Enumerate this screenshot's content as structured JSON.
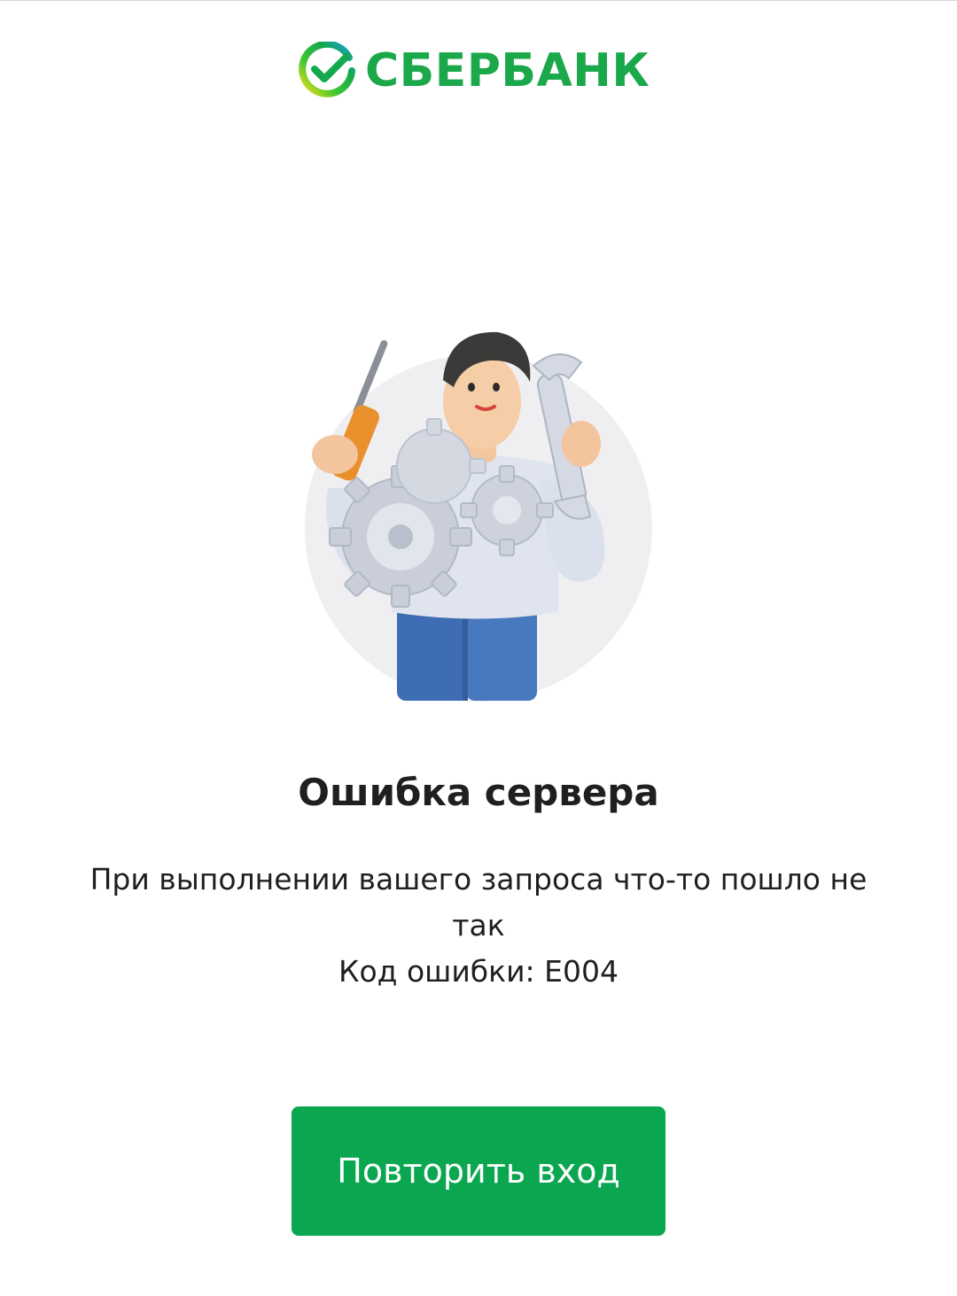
{
  "header": {
    "logo_text": "СБЕРБАНК",
    "logo_icon": "sber-check-icon"
  },
  "illustration": {
    "icon": "engineer-with-gears-icon"
  },
  "error": {
    "title": "Ошибка сервера",
    "message": "При выполнении вашего запроса что-то пошло не так",
    "code_line": "Код ошибки: E004"
  },
  "actions": {
    "retry_label": "Повторить вход"
  },
  "colors": {
    "brand_green": "#1aa84a",
    "button_green": "#0aa650",
    "text": "#1f1f1f",
    "background": "#ffffff"
  }
}
